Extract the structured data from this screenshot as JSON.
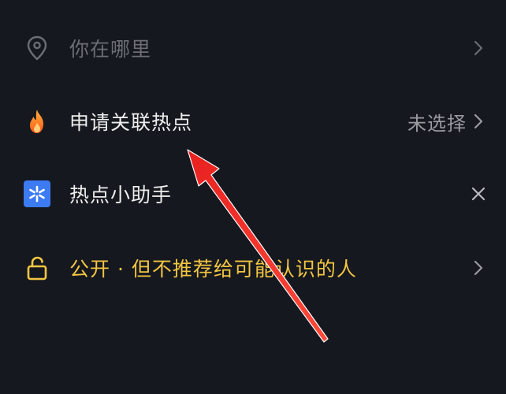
{
  "rows": {
    "location": {
      "label": "你在哪里",
      "icon": "location-pin-icon"
    },
    "hotspot": {
      "label": "申请关联热点",
      "value": "未选择",
      "icon": "flame-icon"
    },
    "helper": {
      "label": "热点小助手",
      "icon": "hotspot-helper-icon"
    },
    "privacy": {
      "label": "公开 · 但不推荐给可能认识的人",
      "icon": "unlock-icon"
    }
  },
  "colors": {
    "background": "#16181f",
    "muted_text": "#6c6e75",
    "primary_text": "#eeeeee",
    "gold_text": "#f2c641",
    "helper_blue": "#3c7bf2",
    "annotation_red": "#e8201f"
  }
}
